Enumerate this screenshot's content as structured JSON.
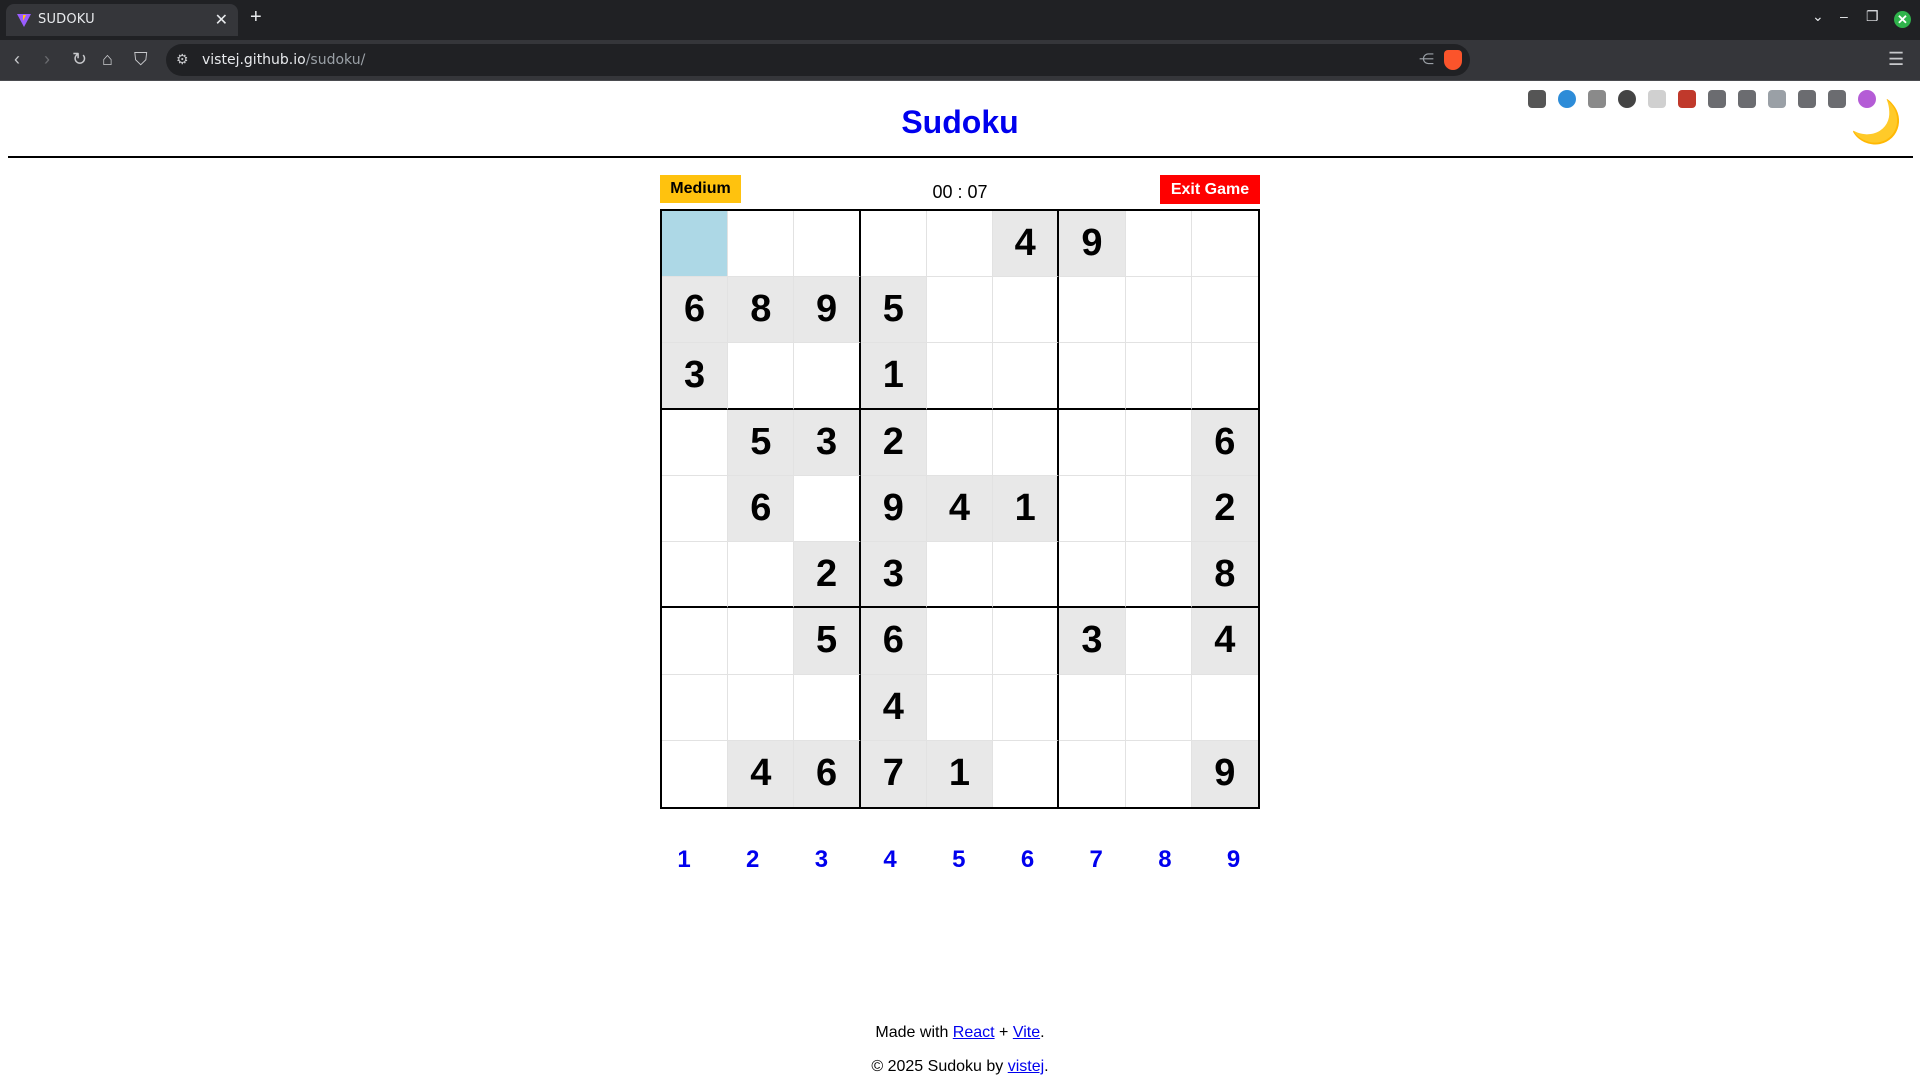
{
  "browser": {
    "tab_title": "SUDOKU",
    "url_host": "vistej.github.io",
    "url_path": "/sudoku/"
  },
  "page": {
    "title": "Sudoku",
    "theme_toggle_icon": "🌙",
    "difficulty": "Medium",
    "timer": "00 : 07",
    "exit_label": "Exit Game"
  },
  "board": {
    "selected": [
      0,
      0
    ],
    "cells": [
      [
        0,
        0,
        0,
        0,
        0,
        4,
        9,
        0,
        0
      ],
      [
        6,
        8,
        9,
        5,
        0,
        0,
        0,
        0,
        0
      ],
      [
        3,
        0,
        0,
        1,
        0,
        0,
        0,
        0,
        0
      ],
      [
        0,
        5,
        3,
        2,
        0,
        0,
        0,
        0,
        6
      ],
      [
        0,
        6,
        0,
        9,
        4,
        1,
        0,
        0,
        2
      ],
      [
        0,
        0,
        2,
        3,
        0,
        0,
        0,
        0,
        8
      ],
      [
        0,
        0,
        5,
        6,
        0,
        0,
        3,
        0,
        4
      ],
      [
        0,
        0,
        0,
        4,
        0,
        0,
        0,
        0,
        0
      ],
      [
        0,
        4,
        6,
        7,
        1,
        0,
        0,
        0,
        9
      ]
    ]
  },
  "numpad": [
    "1",
    "2",
    "3",
    "4",
    "5",
    "6",
    "7",
    "8",
    "9"
  ],
  "footer": {
    "made_with_prefix": "Made with ",
    "react_link": "React",
    "plus": " + ",
    "vite_link": "Vite",
    "made_with_suffix": ".",
    "copyright_prefix": "© 2025 Sudoku by ",
    "author_link": "vistej",
    "copyright_suffix": "."
  },
  "colors": {
    "title": "#0000ee",
    "difficulty_bg": "#ffc20e",
    "exit_bg": "#ff0000",
    "selected_cell": "#add8e6",
    "given_cell": "#e8e8e8"
  }
}
